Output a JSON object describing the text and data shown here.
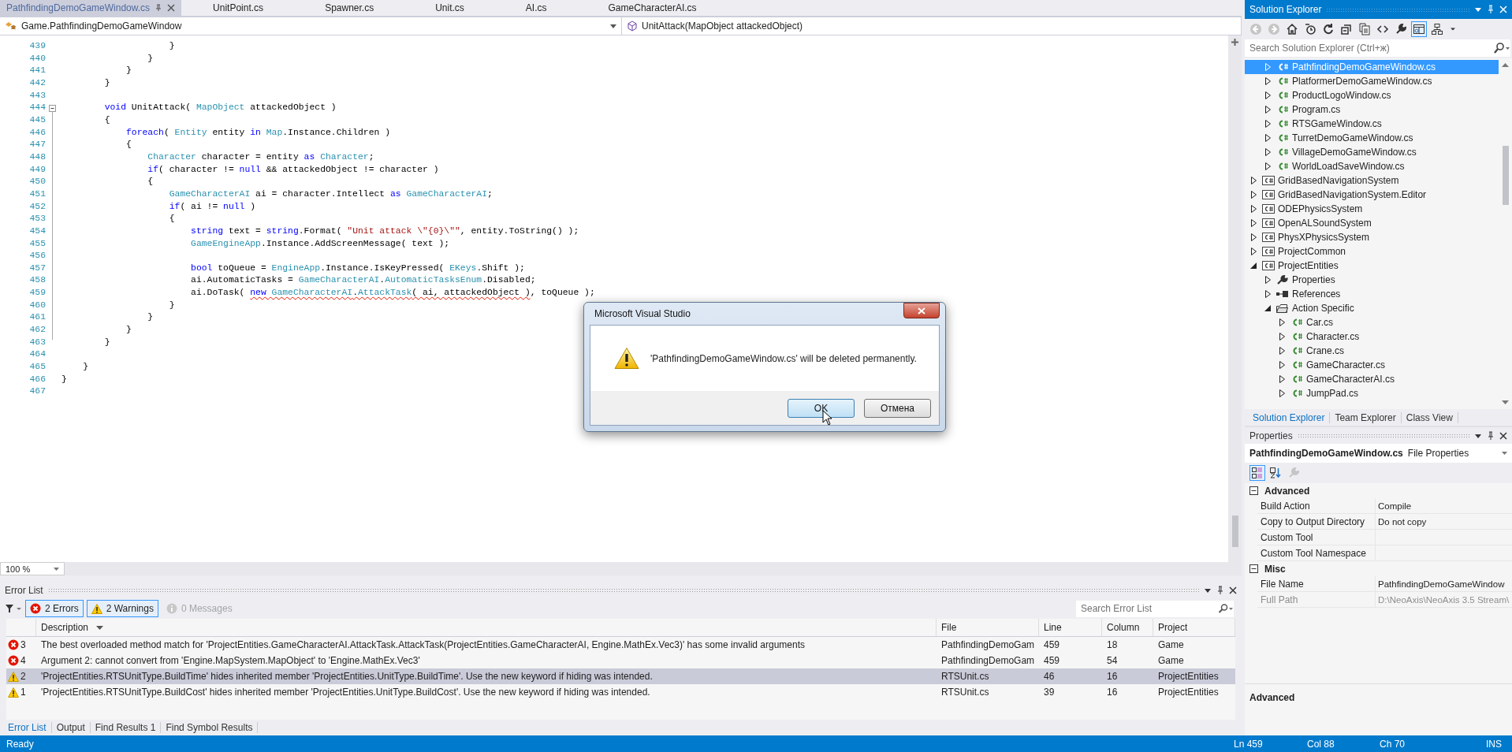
{
  "editor_tabs": [
    {
      "label": "PathfindingDemoGameWindow.cs",
      "selected": true
    },
    {
      "label": "UnitPoint.cs",
      "selected": false
    },
    {
      "label": "Spawner.cs",
      "selected": false
    },
    {
      "label": "Unit.cs",
      "selected": false
    },
    {
      "label": "AI.cs",
      "selected": false
    },
    {
      "label": "GameCharacterAI.cs",
      "selected": false
    }
  ],
  "navigation": {
    "type_dropdown": "Game.PathfindingDemoGameWindow",
    "member_dropdown": "UnitAttack(MapObject attackedObject)"
  },
  "code": {
    "lines": [
      {
        "number": "439",
        "tokens": [
          {
            "t": "                    }",
            "kind": "text"
          }
        ]
      },
      {
        "number": "440",
        "tokens": [
          {
            "t": "                }",
            "kind": "text"
          }
        ]
      },
      {
        "number": "441",
        "tokens": [
          {
            "t": "            }",
            "kind": "text"
          }
        ]
      },
      {
        "number": "442",
        "tokens": [
          {
            "t": "        }",
            "kind": "text"
          }
        ]
      },
      {
        "number": "443"
      },
      {
        "number": "444",
        "tokens": [
          {
            "t": "        void",
            "kind": "kw"
          },
          {
            "t": " UnitAttack( ",
            "kind": "text"
          },
          {
            "t": "MapObject",
            "kind": "type"
          },
          {
            "t": " attackedObject )",
            "kind": "text"
          }
        ]
      },
      {
        "number": "445",
        "tokens": [
          {
            "t": "        {",
            "kind": "text"
          }
        ]
      },
      {
        "number": "446",
        "tokens": [
          {
            "t": "            foreach",
            "kind": "kw"
          },
          {
            "t": "( ",
            "kind": "text"
          },
          {
            "t": "Entity",
            "kind": "type"
          },
          {
            "t": " entity ",
            "kind": "text"
          },
          {
            "t": "in ",
            "kind": "kw"
          },
          {
            "t": "Map",
            "kind": "type"
          },
          {
            "t": ".Instance.Children )",
            "kind": "text"
          }
        ]
      },
      {
        "number": "447",
        "tokens": [
          {
            "t": "            {",
            "kind": "text"
          }
        ]
      },
      {
        "number": "448",
        "tokens": [
          {
            "t": "                Character",
            "kind": "type"
          },
          {
            "t": " character = entity ",
            "kind": "text"
          },
          {
            "t": "as ",
            "kind": "kw"
          },
          {
            "t": "Character",
            "kind": "type"
          },
          {
            "t": ";",
            "kind": "text"
          }
        ]
      },
      {
        "number": "449",
        "tokens": [
          {
            "t": "                if",
            "kind": "kw"
          },
          {
            "t": "( character != ",
            "kind": "text"
          },
          {
            "t": "null",
            "kind": "kw"
          },
          {
            "t": " && attackedObject != character )",
            "kind": "text"
          }
        ]
      },
      {
        "number": "450",
        "tokens": [
          {
            "t": "                {",
            "kind": "text"
          }
        ]
      },
      {
        "number": "451",
        "tokens": [
          {
            "t": "                    GameCharacterAI",
            "kind": "type"
          },
          {
            "t": " ai = character.Intellect ",
            "kind": "text"
          },
          {
            "t": "as ",
            "kind": "kw"
          },
          {
            "t": "GameCharacterAI",
            "kind": "type"
          },
          {
            "t": ";",
            "kind": "text"
          }
        ]
      },
      {
        "number": "452",
        "tokens": [
          {
            "t": "                    if",
            "kind": "kw"
          },
          {
            "t": "( ai != ",
            "kind": "text"
          },
          {
            "t": "null",
            "kind": "kw"
          },
          {
            "t": " )",
            "kind": "text"
          }
        ]
      },
      {
        "number": "453",
        "tokens": [
          {
            "t": "                    {",
            "kind": "text"
          }
        ]
      },
      {
        "number": "454",
        "tokens": [
          {
            "t": "                        string",
            "kind": "kw"
          },
          {
            "t": " text = ",
            "kind": "text"
          },
          {
            "t": "string",
            "kind": "kw"
          },
          {
            "t": ".Format( ",
            "kind": "text"
          },
          {
            "t": "\"Unit attack \\\"{0}\\\"\"",
            "kind": "str"
          },
          {
            "t": ", entity.ToString() );",
            "kind": "text"
          }
        ]
      },
      {
        "number": "455",
        "tokens": [
          {
            "t": "                        GameEngineApp",
            "kind": "type"
          },
          {
            "t": ".Instance.AddScreenMessage( text );",
            "kind": "text"
          }
        ]
      },
      {
        "number": "456"
      },
      {
        "number": "457",
        "tokens": [
          {
            "t": "                        bool",
            "kind": "kw"
          },
          {
            "t": " toQueue = ",
            "kind": "text"
          },
          {
            "t": "EngineApp",
            "kind": "type"
          },
          {
            "t": ".Instance.IsKeyPressed( ",
            "kind": "text"
          },
          {
            "t": "EKeys",
            "kind": "type"
          },
          {
            "t": ".Shift );",
            "kind": "text"
          }
        ]
      },
      {
        "number": "458",
        "tokens": [
          {
            "t": "                        ai.AutomaticTasks = ",
            "kind": "text"
          },
          {
            "t": "GameCharacterAI",
            "kind": "type"
          },
          {
            "t": ".",
            "kind": "text"
          },
          {
            "t": "AutomaticTasksEnum",
            "kind": "type"
          },
          {
            "t": ".Disabled;",
            "kind": "text"
          }
        ]
      },
      {
        "number": "459",
        "tokens": [
          {
            "t": "                        ai.DoTask( ",
            "kind": "text"
          },
          {
            "t": "new ",
            "kind": "kw_err"
          },
          {
            "t": "GameCharacterAI",
            "kind": "type_err"
          },
          {
            "t": ".",
            "kind": "text_err"
          },
          {
            "t": "AttackTask",
            "kind": "type_err"
          },
          {
            "t": "( ai, attackedObject )",
            "kind": "text_err"
          },
          {
            "t": ", toQueue );",
            "kind": "text"
          }
        ]
      },
      {
        "number": "460",
        "tokens": [
          {
            "t": "                    }",
            "kind": "text"
          }
        ]
      },
      {
        "number": "461",
        "tokens": [
          {
            "t": "                }",
            "kind": "text"
          }
        ]
      },
      {
        "number": "462",
        "tokens": [
          {
            "t": "            }",
            "kind": "text"
          }
        ]
      },
      {
        "number": "463",
        "tokens": [
          {
            "t": "        }",
            "kind": "text"
          }
        ]
      },
      {
        "number": "464"
      },
      {
        "number": "465",
        "tokens": [
          {
            "t": "    }",
            "kind": "text"
          }
        ]
      },
      {
        "number": "466",
        "tokens": [
          {
            "t": "}",
            "kind": "text"
          }
        ]
      },
      {
        "number": "467"
      }
    ],
    "zoom": "100 %"
  },
  "error_list": {
    "title": "Error List",
    "filters": [
      {
        "label": "2 Errors",
        "kind": "error",
        "on": true
      },
      {
        "label": "2 Warnings",
        "kind": "warning",
        "on": true
      },
      {
        "label": "0 Messages",
        "kind": "info",
        "on": false
      }
    ],
    "search": {
      "placeholder": "Search Error List"
    },
    "columns": [
      {
        "label": "Description",
        "sorted": true
      },
      {
        "label": "File",
        "sorted": false
      },
      {
        "label": "Line",
        "sorted": false
      },
      {
        "label": "Column",
        "sorted": false
      },
      {
        "label": "Project",
        "sorted": false
      }
    ],
    "rows": [
      {
        "kind": "error",
        "number": "3",
        "description": "The best overloaded method match for 'ProjectEntities.GameCharacterAI.AttackTask.AttackTask(ProjectEntities.GameCharacterAI, Engine.MathEx.Vec3)' has some invalid arguments",
        "file": "PathfindingDemoGam",
        "line": "459",
        "column": "18",
        "project": "Game",
        "selected": false
      },
      {
        "kind": "error",
        "number": "4",
        "description": "Argument 2: cannot convert from 'Engine.MapSystem.MapObject' to 'Engine.MathEx.Vec3'",
        "file": "PathfindingDemoGam",
        "line": "459",
        "column": "54",
        "project": "Game",
        "selected": false
      },
      {
        "kind": "warning",
        "number": "2",
        "description": "'ProjectEntities.RTSUnitType.BuildTime' hides inherited member 'ProjectEntities.UnitType.BuildTime'. Use the new keyword if hiding was intended.",
        "file": "RTSUnit.cs",
        "line": "46",
        "column": "16",
        "project": "ProjectEntities",
        "selected": true
      },
      {
        "kind": "warning",
        "number": "1",
        "description": "'ProjectEntities.RTSUnitType.BuildCost' hides inherited member 'ProjectEntities.UnitType.BuildCost'. Use the new keyword if hiding was intended.",
        "file": "RTSUnit.cs",
        "line": "39",
        "column": "16",
        "project": "ProjectEntities",
        "selected": false
      }
    ],
    "bottom_tabs": [
      {
        "label": "Error List",
        "selected": true
      },
      {
        "label": "Output",
        "selected": false
      },
      {
        "label": "Find Results 1",
        "selected": false
      },
      {
        "label": "Find Symbol Results",
        "selected": false
      }
    ]
  },
  "solution_explorer": {
    "title": "Solution Explorer",
    "toolbar": [
      {
        "kind": "back",
        "on": false,
        "disabled": true
      },
      {
        "kind": "forward",
        "on": false,
        "disabled": true
      },
      {
        "kind": "home",
        "on": false,
        "disabled": false
      },
      {
        "kind": "history",
        "on": false,
        "disabled": false
      },
      {
        "kind": "refresh",
        "on": false,
        "disabled": false
      },
      {
        "kind": "collapse",
        "on": false,
        "disabled": false
      },
      {
        "kind": "show_files",
        "on": false,
        "disabled": false
      },
      {
        "kind": "code",
        "on": false,
        "disabled": false
      },
      {
        "kind": "wrench",
        "on": false,
        "disabled": false
      },
      {
        "kind": "preview",
        "on": true,
        "disabled": false
      },
      {
        "kind": "diagram",
        "on": false,
        "disabled": false
      },
      {
        "kind": "more",
        "on": false,
        "disabled": false
      }
    ],
    "search": {
      "placeholder": "Search Solution Explorer (Ctrl+ж)"
    },
    "tree": {
      "children_of_scrolled_parent": [
        {
          "label": "PathfindingDemoGameWindow.cs",
          "kind": "file",
          "expanded": false,
          "selected": true
        },
        {
          "label": "PlatformerDemoGameWindow.cs",
          "kind": "file",
          "expanded": false,
          "selected": false
        },
        {
          "label": "ProductLogoWindow.cs",
          "kind": "file",
          "expanded": false,
          "selected": false
        },
        {
          "label": "Program.cs",
          "kind": "file",
          "expanded": false,
          "selected": false
        },
        {
          "label": "RTSGameWindow.cs",
          "kind": "file",
          "expanded": false,
          "selected": false
        },
        {
          "label": "TurretDemoGameWindow.cs",
          "kind": "file",
          "expanded": false,
          "selected": false
        },
        {
          "label": "VillageDemoGameWindow.cs",
          "kind": "file",
          "expanded": false,
          "selected": false
        },
        {
          "label": "WorldLoadSaveWindow.cs",
          "kind": "file",
          "expanded": false,
          "selected": false
        }
      ],
      "items": [
        {
          "label": "GridBasedNavigationSystem",
          "kind": "project",
          "expanded": false,
          "selected": false
        },
        {
          "label": "GridBasedNavigationSystem.Editor",
          "kind": "project",
          "expanded": false,
          "selected": false
        },
        {
          "label": "ODEPhysicsSystem",
          "kind": "project",
          "expanded": false,
          "selected": false
        },
        {
          "label": "OpenALSoundSystem",
          "kind": "project",
          "expanded": false,
          "selected": false
        },
        {
          "label": "PhysXPhysicsSystem",
          "kind": "project",
          "expanded": false,
          "selected": false
        },
        {
          "label": "ProjectCommon",
          "kind": "project",
          "expanded": false,
          "selected": false
        },
        {
          "label": "ProjectEntities",
          "kind": "project",
          "expanded": true,
          "selected": false,
          "children": [
            {
              "label": "Properties",
              "kind": "properties",
              "expanded": false,
              "selected": false
            },
            {
              "label": "References",
              "kind": "references",
              "expanded": false,
              "selected": false
            },
            {
              "label": "Action Specific",
              "kind": "folder",
              "expanded": true,
              "selected": false,
              "children": [
                {
                  "label": "Car.cs",
                  "kind": "file",
                  "expanded": false,
                  "selected": false
                },
                {
                  "label": "Character.cs",
                  "kind": "file",
                  "expanded": false,
                  "selected": false
                },
                {
                  "label": "Crane.cs",
                  "kind": "file",
                  "expanded": false,
                  "selected": false
                },
                {
                  "label": "GameCharacter.cs",
                  "kind": "file",
                  "expanded": false,
                  "selected": false
                },
                {
                  "label": "GameCharacterAI.cs",
                  "kind": "file",
                  "expanded": false,
                  "selected": false
                },
                {
                  "label": "JumpPad.cs",
                  "kind": "file",
                  "expanded": false,
                  "selected": false
                }
              ]
            }
          ]
        }
      ]
    },
    "bottom_tabs": [
      {
        "label": "Solution Explorer",
        "selected": true
      },
      {
        "label": "Team Explorer",
        "selected": false
      },
      {
        "label": "Class View",
        "selected": false
      }
    ]
  },
  "properties": {
    "title": "Properties",
    "object_name": "PathfindingDemoGameWindow.cs",
    "object_type": "File Properties",
    "toolbar": [
      {
        "kind": "categorized",
        "on": true,
        "disabled": false
      },
      {
        "kind": "alphabetical",
        "on": false,
        "disabled": false
      },
      {
        "kind": "pages",
        "on": false,
        "disabled": true
      }
    ],
    "categories": [
      {
        "name": "Advanced",
        "expanded": true,
        "rows": [
          {
            "name": "Build Action",
            "value": "Compile",
            "disabled": false
          },
          {
            "name": "Copy to Output Directory",
            "value": "Do not copy",
            "disabled": false
          },
          {
            "name": "Custom Tool",
            "disabled": false
          },
          {
            "name": "Custom Tool Namespace",
            "disabled": false
          }
        ]
      },
      {
        "name": "Misc",
        "expanded": true,
        "rows": [
          {
            "name": "File Name",
            "value": "PathfindingDemoGameWindow",
            "disabled": false
          },
          {
            "name": "Full Path",
            "value": "D:\\NeoAxis\\NeoAxis 3.5 Stream\\",
            "disabled": true
          }
        ]
      }
    ],
    "description_title": "Advanced"
  },
  "dialog": {
    "title": "Microsoft Visual Studio",
    "message": "'PathfindingDemoGameWindow.cs' will be deleted permanently.",
    "buttons": [
      {
        "label": "OK",
        "default": true
      },
      {
        "label": "Отмена",
        "default": false
      }
    ]
  },
  "status_bar": {
    "message": "Ready",
    "line": "Ln 459",
    "column": "Col 88",
    "char": "Ch 70",
    "mode": "INS"
  }
}
